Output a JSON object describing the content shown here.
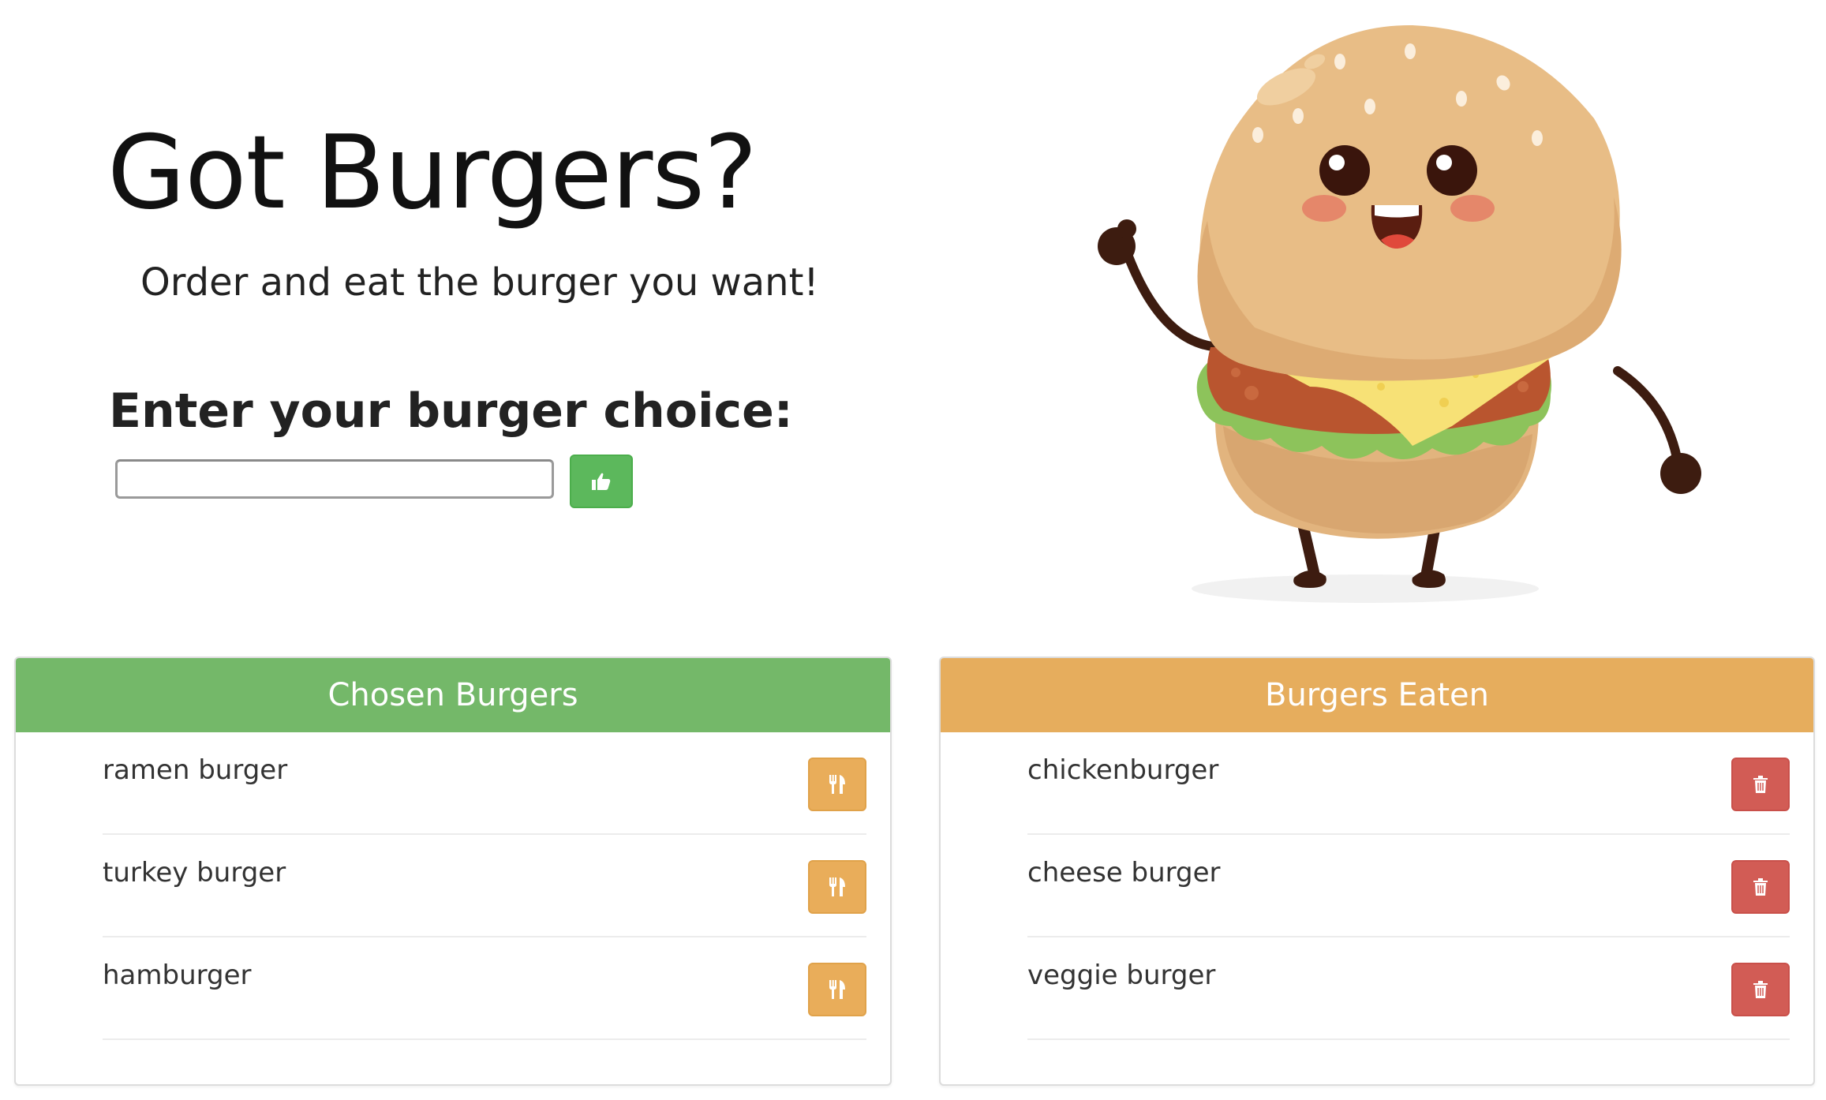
{
  "header": {
    "title": "Got Burgers?",
    "subtitle": "Order and eat the burger you want!"
  },
  "form": {
    "label": "Enter your burger choice:",
    "input_value": "",
    "submit_icon": "thumbs-up-icon"
  },
  "colors": {
    "success": "#5cb85c",
    "chosen_header": "#74b869",
    "eaten_header": "#e6ad5d",
    "devour_button": "#e9ad5a",
    "delete_button": "#d25c55"
  },
  "chosen": {
    "heading": "Chosen Burgers",
    "action_icon": "fork-knife-icon",
    "items": [
      {
        "name": "ramen burger"
      },
      {
        "name": "turkey burger"
      },
      {
        "name": "hamburger"
      }
    ]
  },
  "eaten": {
    "heading": "Burgers Eaten",
    "action_icon": "trash-icon",
    "items": [
      {
        "name": "chickenburger"
      },
      {
        "name": "cheese burger"
      },
      {
        "name": "veggie burger"
      }
    ]
  }
}
